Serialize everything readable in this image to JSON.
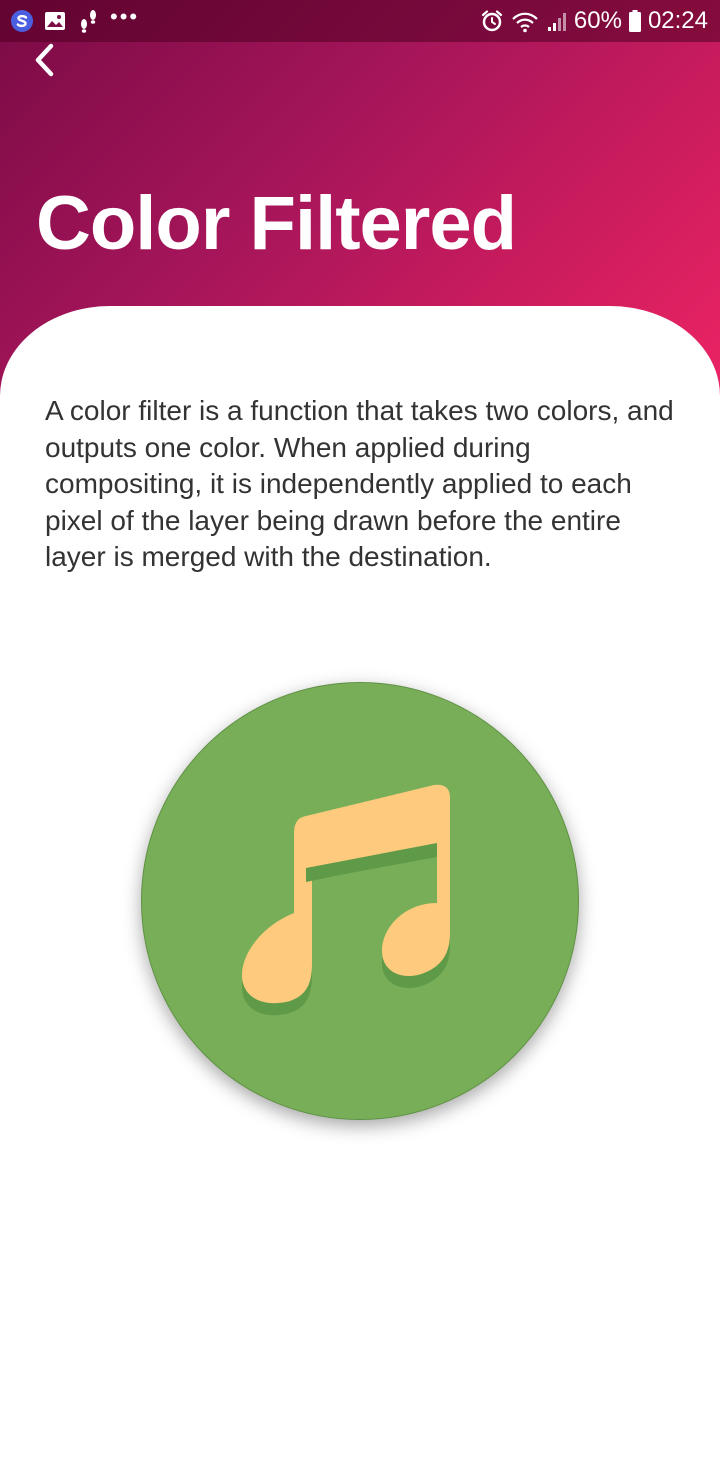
{
  "status_bar": {
    "left_icons": [
      "s-logo-icon",
      "gallery-icon",
      "footsteps-icon",
      "more-dots-icon"
    ],
    "more": "•••",
    "right_icons": [
      "alarm-icon",
      "wifi-icon",
      "signal-icon",
      "battery-icon"
    ],
    "battery": "60%",
    "time": "02:24"
  },
  "header": {
    "back_icon": "chevron-left-icon",
    "title": "Color Filtered",
    "gradient": [
      "#7a0a45",
      "#ee2465"
    ]
  },
  "content": {
    "description": "A color filter is a function that takes two colors, and outputs one color. When applied during compositing, it is independently applied to each pixel of the layer being drawn before the entire layer is merged with the destination."
  },
  "artwork": {
    "icon": "music-note-icon",
    "background_color": "#78ae58",
    "note_color": "#fecb7e",
    "shadow_color": "#5f9a48"
  }
}
